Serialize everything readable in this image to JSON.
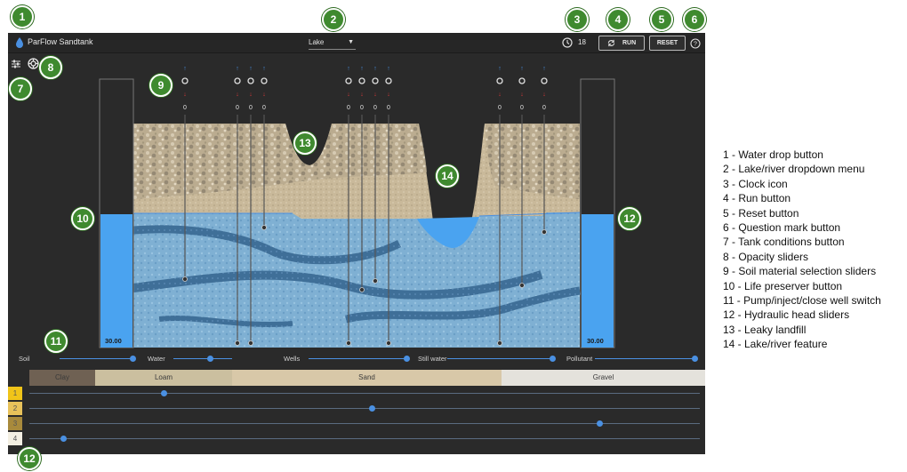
{
  "app": {
    "title": "ParFlow Sandtank",
    "dropdown_value": "Lake",
    "time": "18",
    "run_label": "RUN",
    "reset_label": "RESET",
    "help_label": "?"
  },
  "tanks": {
    "left_value": "30.00",
    "right_value": "30.00"
  },
  "wells": [
    {
      "value": "0"
    },
    {
      "value": "0"
    },
    {
      "value": "0"
    },
    {
      "value": "0"
    },
    {
      "value": "0"
    },
    {
      "value": "0"
    },
    {
      "value": "0"
    },
    {
      "value": "0"
    },
    {
      "value": "0"
    },
    {
      "value": "0"
    },
    {
      "value": "0"
    }
  ],
  "opacity_sliders": [
    {
      "label": "Soil",
      "level": 1.0
    },
    {
      "label": "Water",
      "level": 0.62
    },
    {
      "label": "Wells",
      "level": 1.0
    },
    {
      "label": "Still water",
      "level": 1.0
    },
    {
      "label": "Pollutant",
      "level": 1.0
    }
  ],
  "soil_materials": [
    {
      "label": "Clay"
    },
    {
      "label": "Loam"
    },
    {
      "label": "Sand"
    },
    {
      "label": "Gravel"
    }
  ],
  "layers": [
    {
      "label": "1",
      "level": 0.2
    },
    {
      "label": "2",
      "level": 0.51
    },
    {
      "label": "3",
      "level": 0.85
    },
    {
      "label": "4",
      "level": 0.05
    }
  ],
  "markers": [
    "1",
    "2",
    "3",
    "4",
    "5",
    "6",
    "7",
    "8",
    "9",
    "10",
    "11",
    "12",
    "12",
    "13",
    "14"
  ],
  "legend": [
    "1 - Water drop button",
    "2 - Lake/river dropdown menu",
    "3 - Clock icon",
    "4 - Run button",
    "5 - Reset button",
    "6 - Question mark button",
    "7 - Tank conditions button",
    "8 - Opacity sliders",
    "9 - Soil material selection sliders",
    "10 - Life preserver button",
    "11 - Pump/inject/close well switch",
    "12 - Hydraulic head sliders",
    "13 - Leaky landfill",
    "14 - Lake/river feature"
  ],
  "colors": {
    "accent": "#4a90e2",
    "water": "#4aa3f0",
    "marker": "#3f8a2f"
  }
}
